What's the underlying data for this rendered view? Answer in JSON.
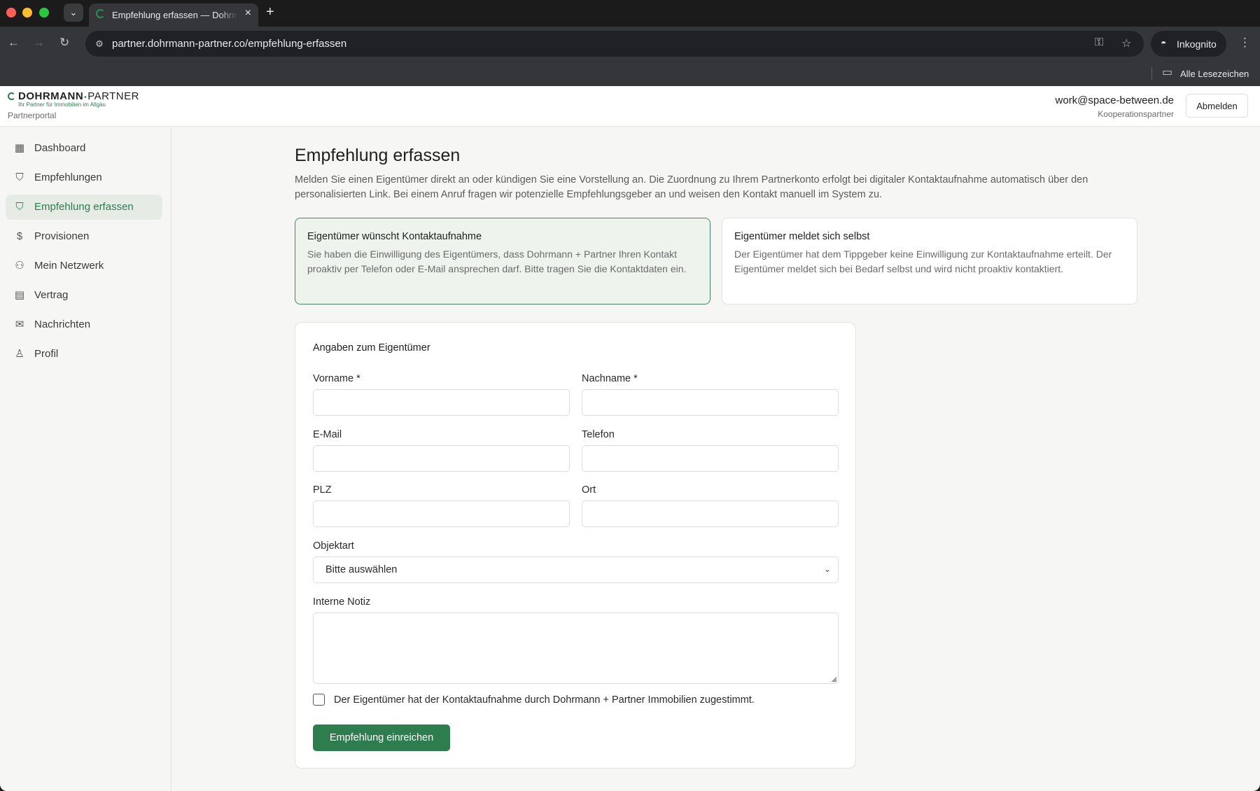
{
  "browser": {
    "tab_title": "Empfehlung erfassen — Dohrmann + Partner",
    "url": "partner.dohrmann-partner.co/empfehlung-erfassen",
    "incognito_label": "Inkognito",
    "bookmarks_label": "Alle Lesezeichen"
  },
  "brand": {
    "name_bold": "DOHRMANN",
    "name_sep": "•",
    "name_rest": "PARTNER",
    "tagline": "Ihr Partner für Immobilien im Allgäu",
    "portal": "Partnerportal",
    "accent_color": "#2e7d4f"
  },
  "sidebar": {
    "items": [
      {
        "label": "Dashboard",
        "icon": "dashboard-icon"
      },
      {
        "label": "Empfehlungen",
        "icon": "handshake-icon"
      },
      {
        "label": "Empfehlung erfassen",
        "icon": "handshake-icon",
        "active": true
      },
      {
        "label": "Provisionen",
        "icon": "commission-icon"
      },
      {
        "label": "Mein Netzwerk",
        "icon": "users-icon"
      },
      {
        "label": "Vertrag",
        "icon": "document-icon"
      },
      {
        "label": "Nachrichten",
        "icon": "mail-icon"
      },
      {
        "label": "Profil",
        "icon": "user-icon"
      }
    ]
  },
  "header": {
    "email": "work@space-between.de",
    "role": "Kooperationspartner",
    "logout_label": "Abmelden"
  },
  "page": {
    "title": "Empfehlung erfassen",
    "intro": "Melden Sie einen Eigentümer direkt an oder kündigen Sie eine Vorstellung an. Die Zuordnung zu Ihrem Partnerkonto erfolgt bei digitaler Kontaktaufnahme automatisch über den personalisierten Link. Bei einem Anruf fragen wir potenzielle Empfehlungsgeber an und weisen den Kontakt manuell im System zu."
  },
  "options": [
    {
      "title": "Eigentümer wünscht Kontaktaufnahme",
      "text": "Sie haben die Einwilligung des Eigentümers, dass Dohrmann + Partner Ihren Kontakt proaktiv per Telefon oder E-Mail ansprechen darf. Bitte tragen Sie die Kontaktdaten ein.",
      "selected": true
    },
    {
      "title": "Eigentümer meldet sich selbst",
      "text": "Der Eigentümer hat dem Tippgeber keine Einwilligung zur Kontaktaufnahme erteilt. Der Eigentümer meldet sich bei Bedarf selbst und wird nicht proaktiv kontaktiert.",
      "selected": false
    }
  ],
  "form": {
    "section_title": "Angaben zum Eigentümer",
    "fields": {
      "vorname": {
        "label": "Vorname *",
        "value": ""
      },
      "nachname": {
        "label": "Nachname *",
        "value": ""
      },
      "email": {
        "label": "E-Mail",
        "value": ""
      },
      "telefon": {
        "label": "Telefon",
        "value": ""
      },
      "plz": {
        "label": "PLZ",
        "value": ""
      },
      "ort": {
        "label": "Ort",
        "value": ""
      },
      "objektart": {
        "label": "Objektart",
        "selected": "Bitte auswählen"
      },
      "notiz": {
        "label": "Interne Notiz",
        "value": ""
      }
    },
    "consent_label": "Der Eigentümer hat der Kontaktaufnahme durch Dohrmann + Partner Immobilien zugestimmt.",
    "consent_checked": false,
    "submit_label": "Empfehlung einreichen"
  }
}
